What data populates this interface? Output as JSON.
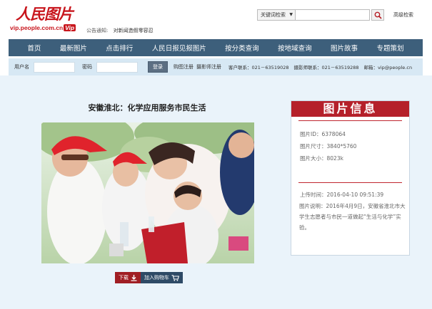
{
  "header": {
    "logo_main": "人民图片",
    "logo_url": "vip.people.com.cn",
    "logo_vip": "Vip",
    "notice_label": "公告通知:",
    "notice_text": "对新闻造假零容忍"
  },
  "search": {
    "select_label": "关键词检索",
    "input_value": "",
    "advanced_label": "高级检索"
  },
  "nav": {
    "items": [
      {
        "label": "首页"
      },
      {
        "label": "最新图片"
      },
      {
        "label": "点击排行"
      },
      {
        "label": "人民日报见报图片"
      },
      {
        "label": "按分类查询"
      },
      {
        "label": "按地域查询"
      },
      {
        "label": "图片故事"
      },
      {
        "label": "专题策划"
      }
    ]
  },
  "login": {
    "username_label": "用户名",
    "password_label": "密码",
    "login_button": "登录",
    "register_buyer": "购图注册",
    "register_photographer": "摄影师注册",
    "customer_contact": "客户联系：021－63519028",
    "photographer_contact": "摄影师联系：021－63519288",
    "email": "邮箱：vip@people.cn"
  },
  "photo": {
    "title": "安徽淮北：化学应用服务市民生活"
  },
  "actions": {
    "download_label": "下载",
    "cart_label": "加入购物车"
  },
  "info": {
    "heading": "图片信息",
    "photo_id": "图片ID：6378064",
    "photo_size": "图片尺寸：3840*5760",
    "photo_filesize": "图片大小：8023k",
    "upload_time": "上传时间：2016-04-10 09:51:39",
    "description": "图片说明：2016年4月9日，安徽省淮北市大学生志愿者与市民一道做起“生活与化学”实验。"
  },
  "colors": {
    "brand_red": "#c8161d",
    "nav_bg": "#3d5f7b",
    "login_bar_bg": "#d7e8f4",
    "content_bg": "#eaf3fa",
    "info_header": "#b5202a",
    "cart_btn": "#2e4a66",
    "download_btn": "#a01e24"
  },
  "icons": {
    "search": "search-icon",
    "dropdown": "caret-down-icon",
    "download": "download-icon",
    "cart": "cart-icon"
  }
}
